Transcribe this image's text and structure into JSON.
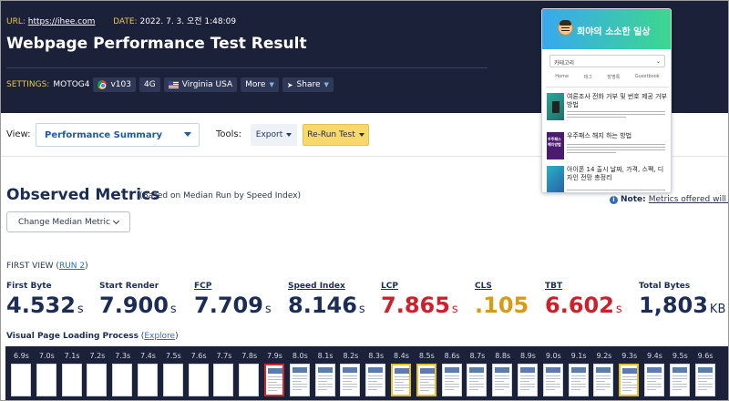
{
  "meta": {
    "url_label": "URL:",
    "url": "https://ihee.com",
    "date_label": "DATE:",
    "date": "2022. 7. 3. 오전 1:48:09"
  },
  "title": "Webpage Performance Test Result",
  "settings": {
    "label": "SETTINGS:",
    "device": "MOTOG4",
    "browser": "v103",
    "connection": "4G",
    "location": "Virginia USA",
    "more": "More",
    "share": "Share"
  },
  "toolbar": {
    "view_label": "View:",
    "view_value": "Performance Summary",
    "tools_label": "Tools:",
    "export_label": "Export",
    "rerun_label": "Re-Run Test"
  },
  "observed": {
    "title": "Observed Metrics",
    "subtitle": "(Based on Median Run by Speed Index)",
    "note_label": "Note:",
    "note_text": "Metrics offered will vary",
    "median_button": "Change Median Metric"
  },
  "first_view": {
    "label": "FIRST VIEW (",
    "run_link": "RUN 2",
    "close": ")"
  },
  "metrics": [
    {
      "label": "First Byte",
      "value": "4.532",
      "unit": "s"
    },
    {
      "label": "Start Render",
      "value": "7.900",
      "unit": "s"
    },
    {
      "label": "FCP",
      "value": "7.709",
      "unit": "s"
    },
    {
      "label": "Speed Index",
      "value": "8.146",
      "unit": "s"
    },
    {
      "label": "LCP",
      "value": "7.865",
      "unit": "s"
    },
    {
      "label": "CLS",
      "value": ".105",
      "unit": ""
    },
    {
      "label": "TBT",
      "value": "6.602",
      "unit": "s"
    },
    {
      "label": "Total Bytes",
      "value": "1,803",
      "unit": "KB"
    }
  ],
  "visual": {
    "label": "Visual Page Loading Process",
    "open": " (",
    "link": "Explore",
    "close": ")"
  },
  "filmstrip": [
    "6.9s",
    "7.0s",
    "7.1s",
    "7.2s",
    "7.3s",
    "7.4s",
    "7.5s",
    "7.6s",
    "7.7s",
    "7.8s",
    "7.9s",
    "8.0s",
    "8.1s",
    "8.2s",
    "8.3s",
    "8.4s",
    "8.5s",
    "8.6s",
    "8.7s",
    "8.8s",
    "8.9s",
    "9.0s",
    "9.1s",
    "9.2s",
    "9.3s",
    "9.4s",
    "9.5s",
    "9.6s"
  ],
  "popup": {
    "title": "희야의 소소한 일상",
    "select": "카테고리",
    "nav": [
      "Home",
      "태그",
      "방명록",
      "Guestbook"
    ],
    "items": [
      {
        "title": "여론조사 전화 거부 및 번호 제공 거부 방법"
      },
      {
        "title": "우주패스 해지 하는 방법",
        "thumb": "우주패스 해지방법"
      },
      {
        "title": "아이폰 14 출시 날짜, 가격, 스펙, 디자인 전망 총정리"
      }
    ]
  },
  "colors": {
    "header_bg": "#1b2138",
    "accent_yellow": "#e9c845",
    "link_blue": "#2d6cc0",
    "lcp_red": "#cf1f2b",
    "cls_orange": "#d99a14"
  }
}
